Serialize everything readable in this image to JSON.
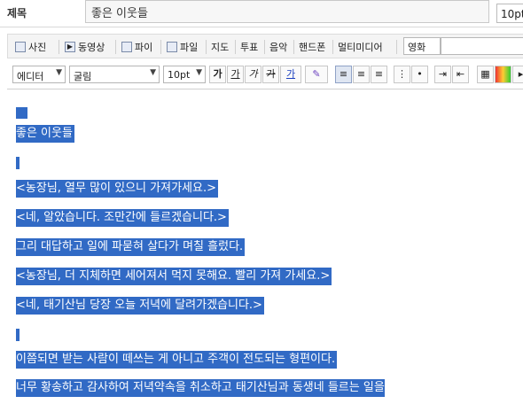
{
  "title_row": {
    "label": "제목",
    "value": "좋은 이웃들",
    "size": "10pt"
  },
  "toolbar1": {
    "items": [
      "사진",
      "동영상",
      "파이",
      "파일",
      "지도",
      "투표",
      "음악",
      "핸드폰",
      "멀티미디어"
    ],
    "lang_select": "영화"
  },
  "toolbar2": {
    "mode": "에디터",
    "font": "굴림",
    "size": "10pt",
    "buttons": [
      "가",
      "가",
      "가",
      "가",
      "가"
    ]
  },
  "content": {
    "lines": [
      "좋은 이웃들",
      "<농장님, 열무 많이 있으니 가져가세요.>",
      "<네, 알았습니다. 조만간에 들르겠습니다.>",
      "그리 대답하고 일에 파묻혀 살다가 며칠 흘렀다.",
      "<농장님, 더 지체하면 세어져서 먹지 못해요. 빨리 가져 가세요.>",
      "<네, 태기산님 당장 오늘 저녁에 달려가겠습니다.>",
      "이쯤되면 받는 사람이 떼쓰는 게 아니고 주객이 전도되는 형편이다.",
      "너무 황송하고 감사하여 저녁약속을 취소하고 태기산님과 동생네 들르는 일을"
    ]
  },
  "colors": {
    "selection": "#316ac5"
  }
}
